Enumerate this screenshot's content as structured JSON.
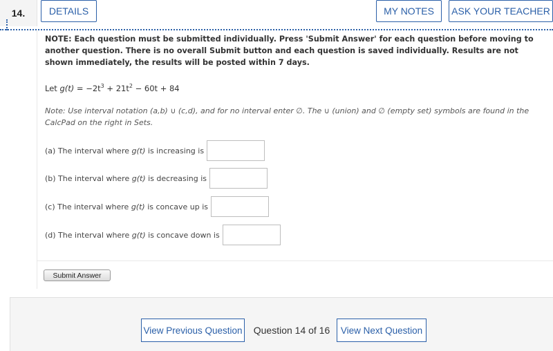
{
  "header": {
    "question_number": "14.",
    "details_label": "DETAILS",
    "my_notes_label": "MY NOTES",
    "ask_teacher_label": "ASK YOUR TEACHER"
  },
  "question": {
    "note": "NOTE: Each question must be submitted individually. Press 'Submit Answer' for each question before moving to another question. There is no overall Submit button and each question is saved individually. Results are not shown immediately, the results will be posted within 7 days.",
    "func_prefix": "Let ",
    "func_name": "g(t)",
    "func_eq": " = −2t",
    "exp3": "3",
    "term2": " + 21t",
    "exp2": "2",
    "term3": " − 60t + 84",
    "hint": "Note: Use interval notation (a,b) ∪ (c,d), and for no interval enter ∅. The ∪ (union) and ∅ (empty set) symbols are found in the CalcPad on the right in Sets.",
    "parts": [
      {
        "label": "(a) The interval where ",
        "func": "g(t)",
        "suffix": " is increasing is",
        "value": ""
      },
      {
        "label": "(b) The interval where ",
        "func": "g(t)",
        "suffix": " is decreasing is",
        "value": ""
      },
      {
        "label": "(c) The interval where ",
        "func": "g(t)",
        "suffix": " is concave up is",
        "value": ""
      },
      {
        "label": "(d) The interval where ",
        "func": "g(t)",
        "suffix": " is concave down is",
        "value": ""
      }
    ],
    "submit_label": "Submit Answer"
  },
  "navigation": {
    "prev_label": "View Previous Question",
    "counter": "Question 14 of 16",
    "next_label": "View Next Question"
  },
  "colors": {
    "accent": "#2a5fa8",
    "panel_bg": "#f5f5f5"
  }
}
